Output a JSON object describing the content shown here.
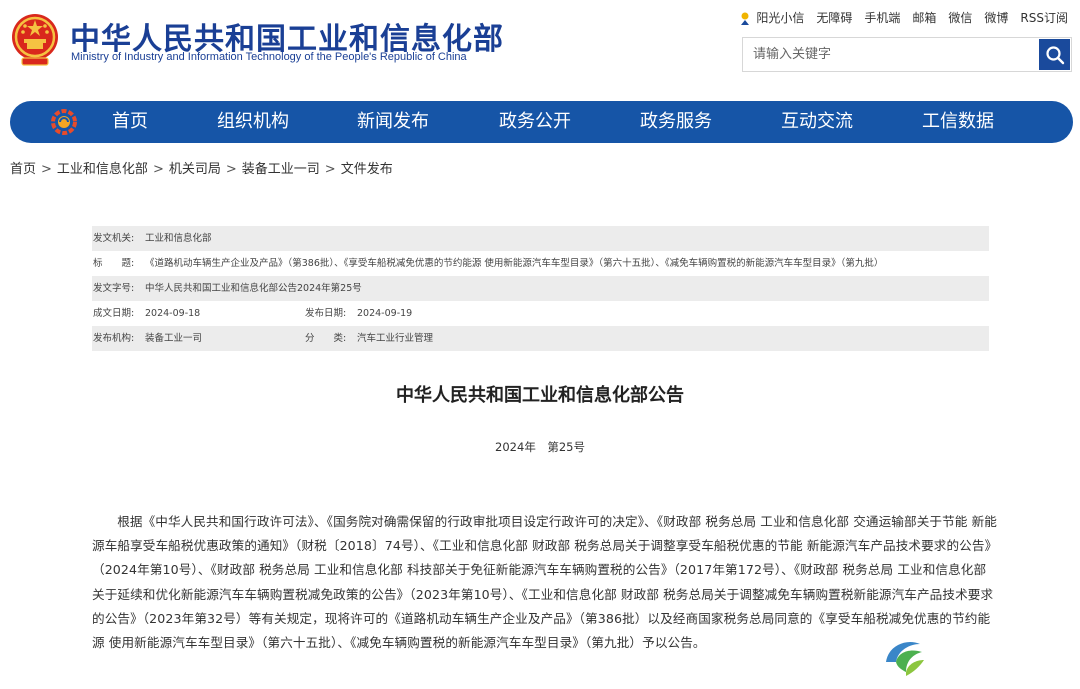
{
  "header": {
    "title_cn": "中华人民共和国工业和信息化部",
    "title_en": "Ministry of Industry and Information Technology of the People's Republic of China",
    "emblem_icon": "national-emblem-icon"
  },
  "toplinks": {
    "sunshine": "阳光小信",
    "accessibility": "无障碍",
    "mobile": "手机端",
    "mail": "邮箱",
    "wechat": "微信",
    "weibo": "微博",
    "rss": "RSS订阅"
  },
  "search": {
    "placeholder": "请输入关键字"
  },
  "nav": {
    "items": [
      "首页",
      "组织机构",
      "新闻发布",
      "政务公开",
      "政务服务",
      "互动交流",
      "工信数据"
    ]
  },
  "breadcrumb": [
    "首页",
    "工业和信息化部",
    "机关司局",
    "装备工业一司",
    "文件发布"
  ],
  "info": {
    "issuer_label": "发文机关:",
    "issuer": "工业和信息化部",
    "title_label": "标　　题:",
    "title": "《道路机动车辆生产企业及产品》（第386批）、《享受车船税减免优惠的节约能源 使用新能源汽车车型目录》（第六十五批）、《减免车辆购置税的新能源汽车车型目录》（第九批）",
    "docno_label": "发文字号:",
    "docno": "中华人民共和国工业和信息化部公告2024年第25号",
    "created_label": "成文日期:",
    "created": "2024-09-18",
    "published_label": "发布日期:",
    "published": "2024-09-19",
    "org_label": "发布机构:",
    "org": "装备工业一司",
    "category_label": "分　　类:",
    "category": "汽车工业行业管理"
  },
  "article": {
    "title": "中华人民共和国工业和信息化部公告",
    "number": "2024年　第25号",
    "body": "根据《中华人民共和国行政许可法》、《国务院对确需保留的行政审批项目设定行政许可的决定》、《财政部 税务总局 工业和信息化部 交通运输部关于节能 新能源车船享受车船税优惠政策的通知》（财税〔2018〕74号）、《工业和信息化部 财政部 税务总局关于调整享受车船税优惠的节能 新能源汽车产品技术要求的公告》（2024年第10号）、《财政部 税务总局 工业和信息化部 科技部关于免征新能源汽车车辆购置税的公告》（2017年第172号）、《财政部 税务总局 工业和信息化部关于延续和优化新能源汽车车辆购置税减免政策的公告》（2023年第10号）、《工业和信息化部 财政部 税务总局关于调整减免车辆购置税新能源汽车产品技术要求的公告》（2023年第32号）等有关规定，现将许可的《道路机动车辆生产企业及产品》（第386批）以及经商国家税务总局同意的《享受车船税减免优惠的节约能源 使用新能源汽车车型目录》（第六十五批）、《减免车辆购置税的新能源汽车车型目录》（第九批）予以公告。"
  },
  "colors": {
    "brand": "#1a3f95",
    "nav_bg": "#1655a7",
    "search_btn": "#1a4a9c",
    "row_shade": "#ececec"
  }
}
